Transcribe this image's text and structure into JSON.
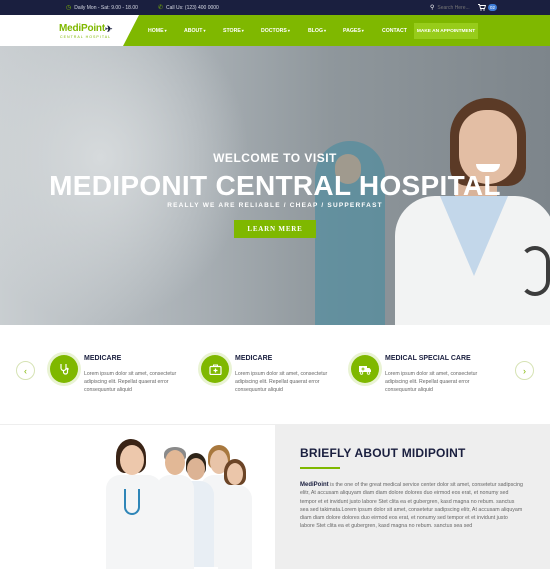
{
  "topbar": {
    "hours": "Daily Mon - Sat: 9.00 - 18.00",
    "phone": "Call Us: (123) 400 0000",
    "search_placeholder": "Search Here...",
    "cart_count": "02"
  },
  "logo": {
    "name": "MediPoint",
    "subtitle": "CENTRAL HOSPITAL"
  },
  "nav": {
    "items": [
      {
        "label": "HOME"
      },
      {
        "label": "ABOUT"
      },
      {
        "label": "STORE"
      },
      {
        "label": "DOCTORS"
      },
      {
        "label": "BLOG"
      },
      {
        "label": "PAGES"
      },
      {
        "label": "CONTACT"
      }
    ],
    "cta": "MAKE AN APPOINTMENT"
  },
  "hero": {
    "welcome": "WELCOME TO VISIT",
    "title": "MEDIPONIT CENTRAL HOSPITAL",
    "tagline": "REALLY WE ARE RELIABLE / CHEAP / SUPPERFAST",
    "button": "LEARN MERE"
  },
  "services": [
    {
      "icon": "stethoscope-icon",
      "title": "MEDICARE",
      "text": "Lorem ipsum dolor sit amet, consectetur adipiscing elit. Repellat quaerat error consequuntur aliquid"
    },
    {
      "icon": "first-aid-kit-icon",
      "title": "MEDICARE",
      "text": "Lorem ipsum dolor sit amet, consectetur adipiscing elit. Repellat quaerat error consequuntur aliquid"
    },
    {
      "icon": "ambulance-icon",
      "title": "MEDICAL SPECIAL CARE",
      "text": "Lorem ipsum dolor sit amet, consectetur adipiscing elit. Repellat quaerat error consequuntur aliquid"
    }
  ],
  "about": {
    "title": "BRIEFLY ABOUT MIDIPOINT",
    "brand": "MediPoint",
    "text": " is the one of the great medical service center dolor sit amet, consetetur sadipscing elitr, At accusam aliquyam diam diam dolore dolores duo eirmod eos erat, et nonumy sed tempor et et invidunt justo labore Stet clita ea et gubergren, kasd magna no rebum. sanctus sea sed takimata.Lorem ipsum dolor sit amet, consetetur sadipscing elitr, At accusam aliquyam diam diam dolore dolores duo eirmod eos erat, et nonumy sed tempor et et invidunt justo labore Stet clita ea et gubergren, kasd magna no rebum. sanctus sea sed"
  },
  "colors": {
    "accent": "#7fb800",
    "navy": "#1a1f3f",
    "about_bg": "#eeeeee"
  }
}
